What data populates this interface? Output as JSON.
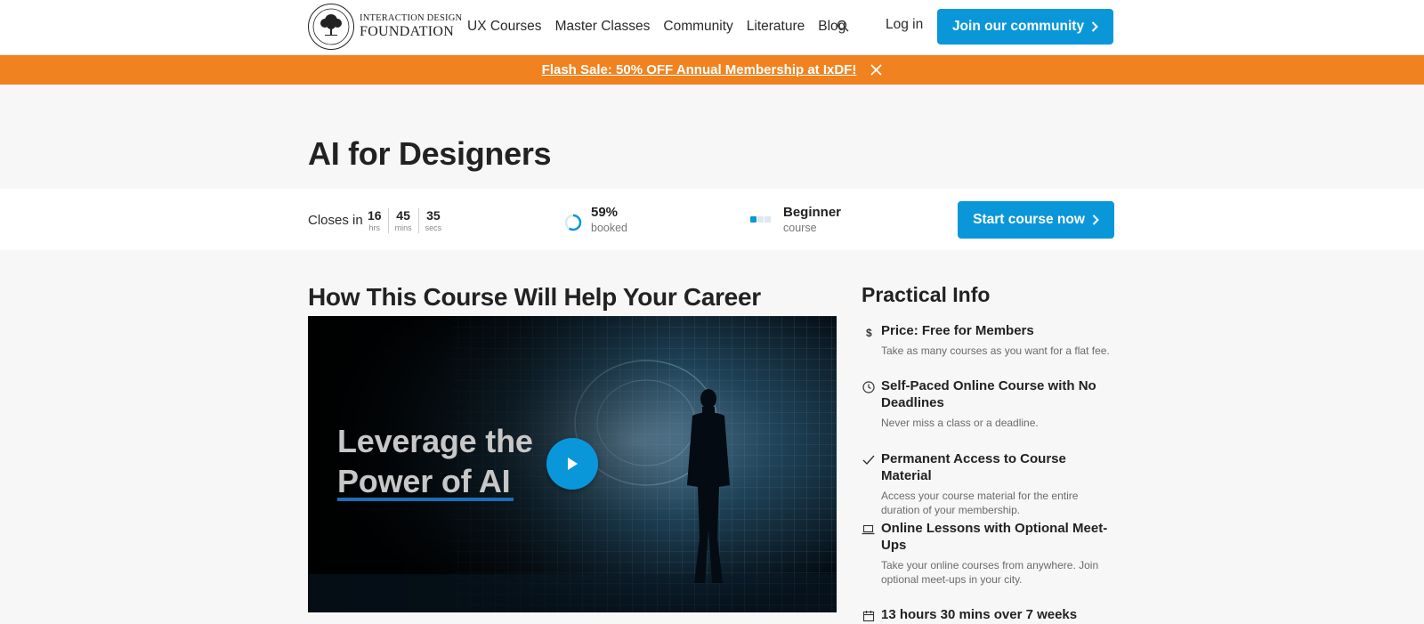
{
  "header": {
    "logo_line1": "INTERACTION DESIGN",
    "logo_line2": "FOUNDATION",
    "nav": [
      "UX Courses",
      "Master Classes",
      "Community",
      "Literature",
      "Blog"
    ],
    "login": "Log in",
    "join": "Join our community"
  },
  "banner": {
    "text": "Flash Sale: 50% OFF Annual Membership at IxDF!"
  },
  "page": {
    "title": "AI for Designers"
  },
  "infobar": {
    "closes_label": "Closes in",
    "countdown": [
      {
        "value": "16",
        "unit": "hrs"
      },
      {
        "value": "45",
        "unit": "mins"
      },
      {
        "value": "35",
        "unit": "secs"
      }
    ],
    "booked_value": "59%",
    "booked_label": "booked",
    "booked_fraction": 0.59,
    "level_value": "Beginner",
    "level_label": "course",
    "level_filled": 1,
    "level_total": 3,
    "start_button": "Start course now"
  },
  "main": {
    "section_title": "How This Course Will Help Your Career",
    "video_line1": "Leverage the",
    "video_line2": "Power of AI"
  },
  "practical": {
    "title": "Practical Info",
    "items": [
      {
        "icon": "dollar-icon",
        "title": "Price: Free for Members",
        "desc": "Take as many courses as you want for a flat fee."
      },
      {
        "icon": "clock-icon",
        "title": "Self-Paced Online Course with No Deadlines",
        "desc": "Never miss a class or a deadline."
      },
      {
        "icon": "check-icon",
        "title": "Permanent Access to Course Material",
        "desc": "Access your course material for the entire duration of your membership."
      },
      {
        "icon": "laptop-icon",
        "title": "Online Lessons with Optional Meet-Ups",
        "desc": "Take your online courses from anywhere. Join optional meet-ups in your city."
      },
      {
        "icon": "calendar-icon",
        "title": "13 hours 30 mins over 7 weeks",
        "desc": ""
      }
    ]
  },
  "colors": {
    "accent": "#0a97d9",
    "banner": "#f0831f"
  }
}
